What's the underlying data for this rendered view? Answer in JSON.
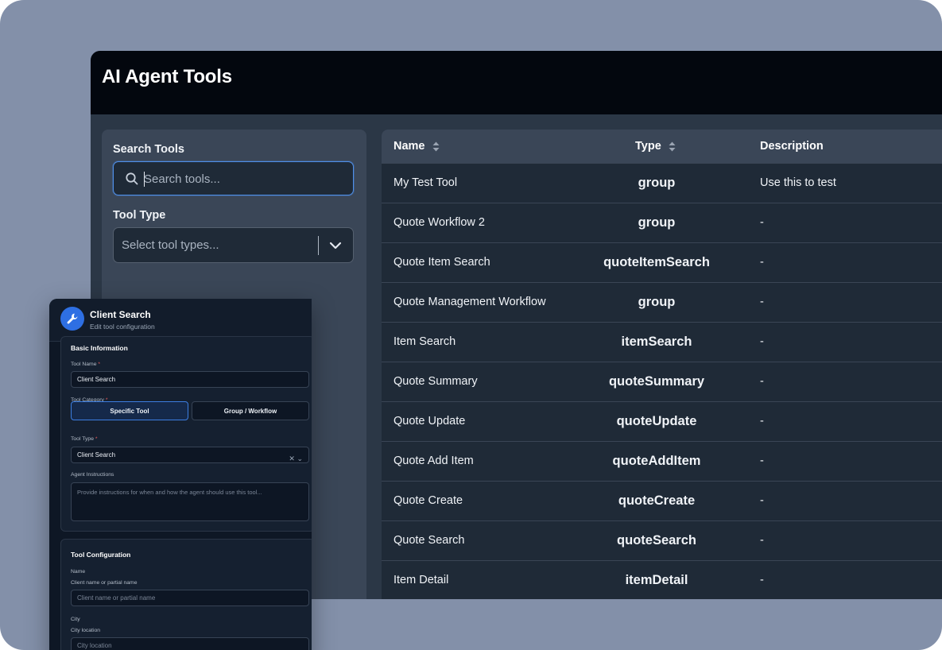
{
  "app": {
    "title": "AI Agent Tools"
  },
  "filters": {
    "search_label": "Search Tools",
    "search_placeholder": "Search tools...",
    "type_label": "Tool Type",
    "type_placeholder": "Select tool types..."
  },
  "table": {
    "columns": {
      "name": "Name",
      "type": "Type",
      "description": "Description"
    },
    "rows": [
      {
        "name": "My Test Tool",
        "type": "group",
        "description": "Use this to test"
      },
      {
        "name": "Quote Workflow 2",
        "type": "group",
        "description": "-"
      },
      {
        "name": "Quote Item Search",
        "type": "quoteItemSearch",
        "description": "-"
      },
      {
        "name": "Quote Management Workflow",
        "type": "group",
        "description": "-"
      },
      {
        "name": "Item Search",
        "type": "itemSearch",
        "description": "-"
      },
      {
        "name": "Quote Summary",
        "type": "quoteSummary",
        "description": "-"
      },
      {
        "name": "Quote Update",
        "type": "quoteUpdate",
        "description": "-"
      },
      {
        "name": "Quote Add Item",
        "type": "quoteAddItem",
        "description": "-"
      },
      {
        "name": "Quote Create",
        "type": "quoteCreate",
        "description": "-"
      },
      {
        "name": "Quote Search",
        "type": "quoteSearch",
        "description": "-"
      },
      {
        "name": "Item Detail",
        "type": "itemDetail",
        "description": "-"
      }
    ]
  },
  "card": {
    "title": "Client Search",
    "subtitle": "Edit tool configuration",
    "basic": {
      "title": "Basic Information",
      "tool_name_label": "Tool Name",
      "tool_name_value": "Client Search",
      "category_label": "Tool Category",
      "category_options": [
        "Specific Tool",
        "Group / Workflow"
      ],
      "tool_type_label": "Tool Type",
      "tool_type_value": "Client Search",
      "instructions_label": "Agent Instructions",
      "instructions_placeholder": "Provide instructions for when and how the agent should use this tool..."
    },
    "config": {
      "title": "Tool Configuration",
      "name_label": "Name",
      "name_hint": "Client name or partial name",
      "name_placeholder": "Client name or partial name",
      "city_label": "City",
      "city_hint": "City location",
      "city_placeholder": "City location"
    },
    "required_mark": "*"
  },
  "colors": {
    "backdrop": "#8390a9",
    "header": "#03070e",
    "panel": "#3a4657",
    "table_bg": "#1f2a37",
    "accent": "#4f8fe9",
    "avatar": "#2e6fe3"
  },
  "icons": {
    "search": "search-icon",
    "chevron": "chevron-down-icon",
    "sort": "sort-icon",
    "wrench": "wrench-icon",
    "clear": "close-icon"
  }
}
